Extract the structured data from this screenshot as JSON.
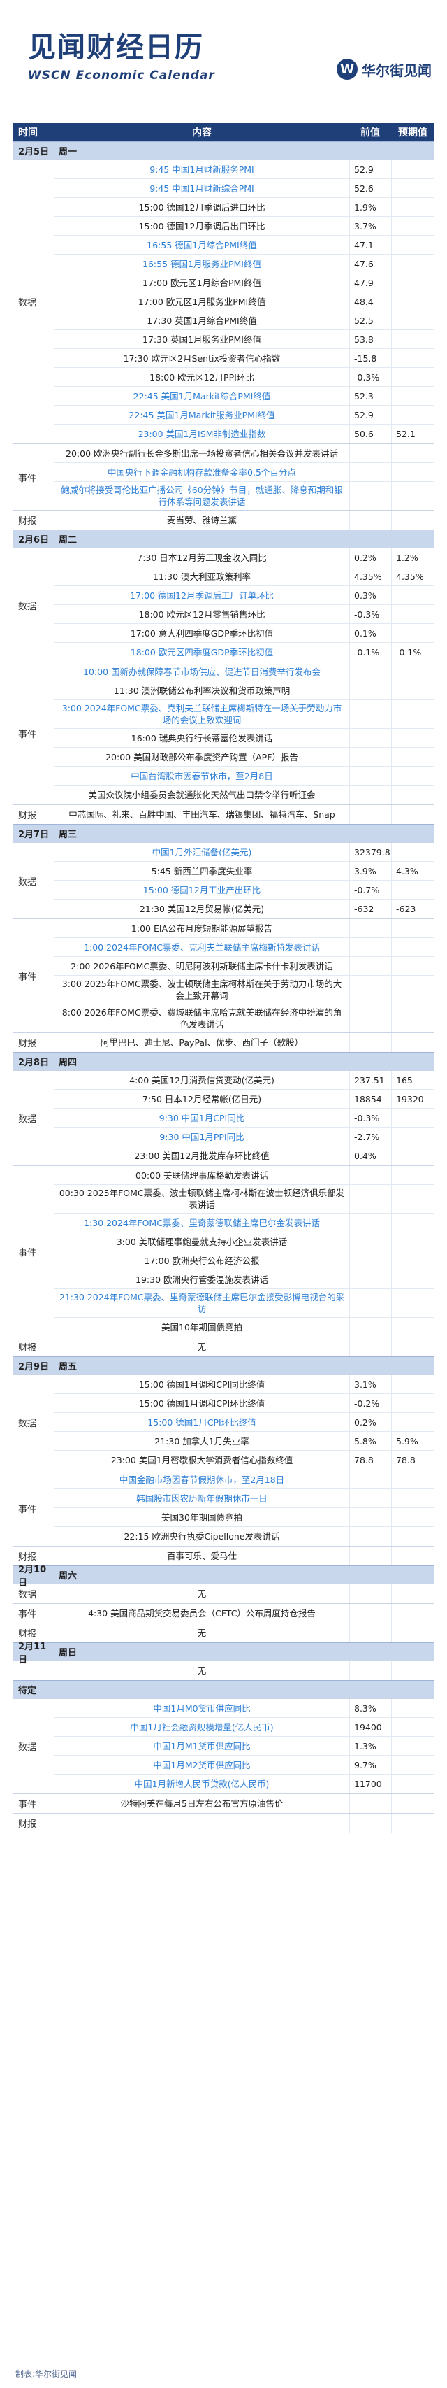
{
  "header": {
    "title": "见闻财经日历",
    "subtitle_en": "WSCN Economic Calendar",
    "brand": "华尔街见闻",
    "brand_mark": "W"
  },
  "table_header": {
    "time": "时间",
    "content": "内容",
    "prev": "前值",
    "exp": "预期值"
  },
  "colors": {
    "navy": "#1f3f78",
    "highlight": "#2d7fd6",
    "day_bg": "#c9d7ec"
  },
  "days": [
    {
      "date": "2月5日",
      "weekday": "周一",
      "sections": [
        {
          "label": "数据",
          "rows": [
            {
              "text": "9:45 中国1月财新服务PMI",
              "prev": "52.9",
              "exp": "",
              "hl": true
            },
            {
              "text": "9:45 中国1月财新综合PMI",
              "prev": "52.6",
              "exp": "",
              "hl": true
            },
            {
              "text": "15:00 德国12月季调后进口环比",
              "prev": "1.9%",
              "exp": "",
              "hl": false
            },
            {
              "text": "15:00 德国12月季调后出口环比",
              "prev": "3.7%",
              "exp": "",
              "hl": false
            },
            {
              "text": "16:55 德国1月综合PMI终值",
              "prev": "47.1",
              "exp": "",
              "hl": true
            },
            {
              "text": "16:55 德国1月服务业PMI终值",
              "prev": "47.6",
              "exp": "",
              "hl": true
            },
            {
              "text": "17:00 欧元区1月综合PMI终值",
              "prev": "47.9",
              "exp": "",
              "hl": false
            },
            {
              "text": "17:00 欧元区1月服务业PMI终值",
              "prev": "48.4",
              "exp": "",
              "hl": false
            },
            {
              "text": "17:30 英国1月综合PMI终值",
              "prev": "52.5",
              "exp": "",
              "hl": false
            },
            {
              "text": "17:30 英国1月服务业PMI终值",
              "prev": "53.8",
              "exp": "",
              "hl": false
            },
            {
              "text": "17:30 欧元区2月Sentix投资者信心指数",
              "prev": "-15.8",
              "exp": "",
              "hl": false
            },
            {
              "text": "18:00 欧元区12月PPI环比",
              "prev": "-0.3%",
              "exp": "",
              "hl": false
            },
            {
              "text": "22:45 美国1月Markit综合PMI终值",
              "prev": "52.3",
              "exp": "",
              "hl": true
            },
            {
              "text": "22:45 美国1月Markit服务业PMI终值",
              "prev": "52.9",
              "exp": "",
              "hl": true
            },
            {
              "text": "23:00 美国1月ISM非制造业指数",
              "prev": "50.6",
              "exp": "52.1",
              "hl": true
            }
          ]
        },
        {
          "label": "事件",
          "rows": [
            {
              "text": "20:00 欧洲央行副行长金多斯出席一场投资者信心相关会议并发表讲话",
              "prev": "",
              "exp": "",
              "hl": false
            },
            {
              "text": "中国央行下调金融机构存款准备金率0.5个百分点",
              "prev": "",
              "exp": "",
              "hl": true
            },
            {
              "text": "鲍威尔将接受哥伦比亚广播公司《60分钟》节目，就通胀、降息预期和银行体系等问题发表讲话",
              "prev": "",
              "exp": "",
              "hl": true
            }
          ]
        },
        {
          "label": "财报",
          "rows": [
            {
              "text": "麦当劳、雅诗兰黛",
              "prev": "",
              "exp": "",
              "hl": false
            }
          ]
        }
      ]
    },
    {
      "date": "2月6日",
      "weekday": "周二",
      "sections": [
        {
          "label": "数据",
          "rows": [
            {
              "text": "7:30 日本12月劳工现金收入同比",
              "prev": "0.2%",
              "exp": "1.2%",
              "hl": false
            },
            {
              "text": "11:30 澳大利亚政策利率",
              "prev": "4.35%",
              "exp": "4.35%",
              "hl": false
            },
            {
              "text": "17:00 德国12月季调后工厂订单环比",
              "prev": "0.3%",
              "exp": "",
              "hl": true
            },
            {
              "text": "18:00 欧元区12月零售销售环比",
              "prev": "-0.3%",
              "exp": "",
              "hl": false
            },
            {
              "text": "17:00 意大利四季度GDP季环比初值",
              "prev": "0.1%",
              "exp": "",
              "hl": false
            },
            {
              "text": "18:00 欧元区四季度GDP季环比初值",
              "prev": "-0.1%",
              "exp": "-0.1%",
              "hl": true
            }
          ]
        },
        {
          "label": "事件",
          "rows": [
            {
              "text": "10:00 国新办就保障春节市场供应、促进节日消费举行发布会",
              "prev": "",
              "exp": "",
              "hl": true
            },
            {
              "text": "11:30 澳洲联储公布利率决议和货币政策声明",
              "prev": "",
              "exp": "",
              "hl": false
            },
            {
              "text": "3:00 2024年FOMC票委、克利夫兰联储主席梅斯特在一场关于劳动力市场的会议上致欢迎词",
              "prev": "",
              "exp": "",
              "hl": true
            },
            {
              "text": "16:00 瑞典央行行长蒂塞伦发表讲话",
              "prev": "",
              "exp": "",
              "hl": false
            },
            {
              "text": "20:00 美国财政部公布季度资产购置（APF）报告",
              "prev": "",
              "exp": "",
              "hl": false
            },
            {
              "text": "中国台湾股市因春节休市，至2月8日",
              "prev": "",
              "exp": "",
              "hl": true
            },
            {
              "text": "美国众议院小组委员会就通胀化天然气出口禁令举行听证会",
              "prev": "",
              "exp": "",
              "hl": false
            }
          ]
        },
        {
          "label": "财报",
          "rows": [
            {
              "text": "中芯国际、礼来、百胜中国、丰田汽车、瑞银集团、福特汽车、Snap",
              "prev": "",
              "exp": "",
              "hl": false
            }
          ]
        }
      ]
    },
    {
      "date": "2月7日",
      "weekday": "周三",
      "sections": [
        {
          "label": "数据",
          "rows": [
            {
              "text": "中国1月外汇储备(亿美元)",
              "prev": "32379.8",
              "exp": "",
              "hl": true
            },
            {
              "text": "5:45 新西兰四季度失业率",
              "prev": "3.9%",
              "exp": "4.3%",
              "hl": false
            },
            {
              "text": "15:00 德国12月工业产出环比",
              "prev": "-0.7%",
              "exp": "",
              "hl": true
            },
            {
              "text": "21:30 美国12月贸易帐(亿美元)",
              "prev": "-632",
              "exp": "-623",
              "hl": false
            }
          ]
        },
        {
          "label": "事件",
          "rows": [
            {
              "text": "1:00 EIA公布月度短期能源展望报告",
              "prev": "",
              "exp": "",
              "hl": false
            },
            {
              "text": "1:00 2024年FOMC票委、克利夫兰联储主席梅斯特发表讲话",
              "prev": "",
              "exp": "",
              "hl": true
            },
            {
              "text": "2:00 2026年FOMC票委、明尼阿波利斯联储主席卡什卡利发表讲话",
              "prev": "",
              "exp": "",
              "hl": false
            },
            {
              "text": "3:00 2025年FOMC票委、波士顿联储主席柯林斯在关于劳动力市场的大会上致开幕词",
              "prev": "",
              "exp": "",
              "hl": false
            },
            {
              "text": "8:00 2026年FOMC票委、费城联储主席哈克就美联储在经济中扮演的角色发表讲话",
              "prev": "",
              "exp": "",
              "hl": false
            }
          ]
        },
        {
          "label": "财报",
          "rows": [
            {
              "text": "阿里巴巴、迪士尼、PayPal、优步、西门子（歌股）",
              "prev": "",
              "exp": "",
              "hl": false
            }
          ]
        }
      ]
    },
    {
      "date": "2月8日",
      "weekday": "周四",
      "sections": [
        {
          "label": "数据",
          "rows": [
            {
              "text": "4:00 美国12月消费信贷变动(亿美元)",
              "prev": "237.51",
              "exp": "165",
              "hl": false
            },
            {
              "text": "7:50 日本12月经常帐(亿日元)",
              "prev": "18854",
              "exp": "19320",
              "hl": false
            },
            {
              "text": "9:30 中国1月CPI同比",
              "prev": "-0.3%",
              "exp": "",
              "hl": true
            },
            {
              "text": "9:30 中国1月PPI同比",
              "prev": "-2.7%",
              "exp": "",
              "hl": true
            },
            {
              "text": "23:00 美国12月批发库存环比终值",
              "prev": "0.4%",
              "exp": "",
              "hl": false
            }
          ]
        },
        {
          "label": "事件",
          "rows": [
            {
              "text": "00:00 美联储理事库格勒发表讲话",
              "prev": "",
              "exp": "",
              "hl": false
            },
            {
              "text": "00:30 2025年FOMC票委、波士顿联储主席柯林斯在波士顿经济俱乐部发表讲话",
              "prev": "",
              "exp": "",
              "hl": false
            },
            {
              "text": "1:30 2024年FOMC票委、里奇蒙德联储主席巴尔金发表讲话",
              "prev": "",
              "exp": "",
              "hl": true
            },
            {
              "text": "3:00 美联储理事鲍曼就支持小企业发表讲话",
              "prev": "",
              "exp": "",
              "hl": false
            },
            {
              "text": "17:00 欧洲央行公布经济公报",
              "prev": "",
              "exp": "",
              "hl": false
            },
            {
              "text": "19:30 欧洲央行管委温施发表讲话",
              "prev": "",
              "exp": "",
              "hl": false
            },
            {
              "text": "21:30 2024年FOMC票委、里奇蒙德联储主席巴尔金接受彭博电视台的采访",
              "prev": "",
              "exp": "",
              "hl": true
            },
            {
              "text": "美国10年期国债竞拍",
              "prev": "",
              "exp": "",
              "hl": false
            }
          ]
        },
        {
          "label": "财报",
          "rows": [
            {
              "text": "无",
              "prev": "",
              "exp": "",
              "hl": false
            }
          ]
        }
      ]
    },
    {
      "date": "2月9日",
      "weekday": "周五",
      "sections": [
        {
          "label": "数据",
          "rows": [
            {
              "text": "15:00 德国1月调和CPI同比终值",
              "prev": "3.1%",
              "exp": "",
              "hl": false
            },
            {
              "text": "15:00 德国1月调和CPI环比终值",
              "prev": "-0.2%",
              "exp": "",
              "hl": false
            },
            {
              "text": "15:00 德国1月CPI环比终值",
              "prev": "0.2%",
              "exp": "",
              "hl": true
            },
            {
              "text": "21:30 加拿大1月失业率",
              "prev": "5.8%",
              "exp": "5.9%",
              "hl": false
            },
            {
              "text": "23:00 美国1月密歇根大学消费者信心指数终值",
              "prev": "78.8",
              "exp": "78.8",
              "hl": false
            }
          ]
        },
        {
          "label": "事件",
          "rows": [
            {
              "text": "中国金融市场因春节假期休市，至2月18日",
              "prev": "",
              "exp": "",
              "hl": true
            },
            {
              "text": "韩国股市因农历新年假期休市一日",
              "prev": "",
              "exp": "",
              "hl": true
            },
            {
              "text": "美国30年期国债竞拍",
              "prev": "",
              "exp": "",
              "hl": false
            },
            {
              "text": "22:15 欧洲央行执委Cipellone发表讲话",
              "prev": "",
              "exp": "",
              "hl": false
            }
          ]
        },
        {
          "label": "财报",
          "rows": [
            {
              "text": "百事可乐、爱马仕",
              "prev": "",
              "exp": "",
              "hl": false
            }
          ]
        }
      ]
    },
    {
      "date": "2月10日",
      "weekday": "周六",
      "sections": [
        {
          "label": "数据",
          "rows": [
            {
              "text": "无",
              "prev": "",
              "exp": "",
              "hl": false
            }
          ]
        },
        {
          "label": "事件",
          "rows": [
            {
              "text": "4:30 美国商品期货交易委员会（CFTC）公布周度持仓报告",
              "prev": "",
              "exp": "",
              "hl": false
            }
          ]
        },
        {
          "label": "财报",
          "rows": [
            {
              "text": "无",
              "prev": "",
              "exp": "",
              "hl": false
            }
          ]
        }
      ]
    },
    {
      "date": "2月11日",
      "weekday": "周日",
      "sections": [
        {
          "label": "",
          "rows": [
            {
              "text": "无",
              "prev": "",
              "exp": "",
              "hl": false
            }
          ]
        }
      ]
    },
    {
      "date": "待定",
      "weekday": "",
      "sections": [
        {
          "label": "数据",
          "rows": [
            {
              "text": "中国1月M0货币供应同比",
              "prev": "8.3%",
              "exp": "",
              "hl": true
            },
            {
              "text": "中国1月社会融资规模增量(亿人民币)",
              "prev": "19400",
              "exp": "",
              "hl": true
            },
            {
              "text": "中国1月M1货币供应同比",
              "prev": "1.3%",
              "exp": "",
              "hl": true
            },
            {
              "text": "中国1月M2货币供应同比",
              "prev": "9.7%",
              "exp": "",
              "hl": true
            },
            {
              "text": "中国1月新增人民币贷款(亿人民币)",
              "prev": "11700",
              "exp": "",
              "hl": true
            }
          ]
        },
        {
          "label": "事件",
          "rows": [
            {
              "text": "沙特阿美在每月5日左右公布官方原油售价",
              "prev": "",
              "exp": "",
              "hl": false
            }
          ]
        },
        {
          "label": "财报",
          "rows": [
            {
              "text": "",
              "prev": "",
              "exp": "",
              "hl": false
            }
          ]
        }
      ]
    }
  ],
  "footer": "制表:华尔街见闻"
}
